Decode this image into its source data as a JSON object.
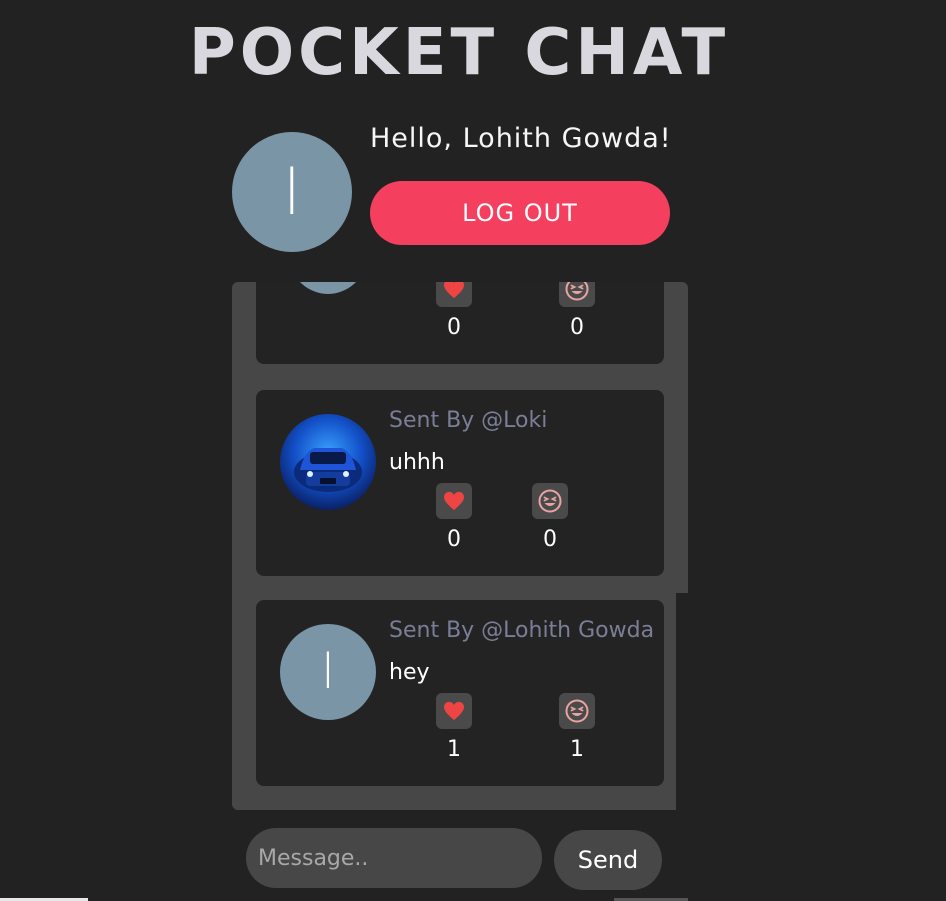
{
  "app": {
    "title": "POCKET CHAT"
  },
  "user": {
    "initial": "l",
    "greeting": "Hello, Lohith Gowda!",
    "logout_label": "LOG OUT"
  },
  "messages": [
    {
      "sender": "",
      "text": "",
      "avatar": "default",
      "avatar_initial": "",
      "likes": "0",
      "laughs": "0"
    },
    {
      "sender": "Sent By @Loki",
      "text": "uhhh",
      "avatar": "car-photo",
      "likes": "0",
      "laughs": "0"
    },
    {
      "sender": "Sent By @Lohith Gowda",
      "text": "hey",
      "avatar": "default",
      "avatar_initial": "l",
      "likes": "1",
      "laughs": "1"
    }
  ],
  "composer": {
    "placeholder": "Message..",
    "send_label": "Send"
  },
  "icons": {
    "like": "heart-icon",
    "laugh": "laughing-face-icon"
  },
  "colors": {
    "accent": "#f43f5f",
    "background": "#222222",
    "panel": "#474747",
    "avatar": "#7a95a5",
    "heart": "#ef4444",
    "laugh": "#e8a3a3"
  }
}
